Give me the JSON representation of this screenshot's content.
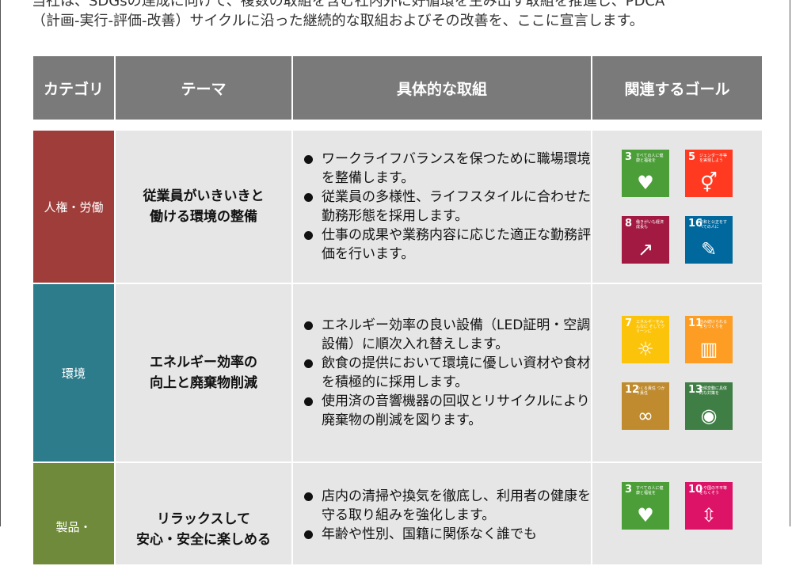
{
  "intro": {
    "line1": "当社は、SDGsの達成に向けて、複数の取組を含む社内外に好循環を生み出す取組を推進し、PDCA",
    "line2": "（計画-実行-評価-改善）サイクルに沿った継続的な取組およびその改善を、ここに宣言します。"
  },
  "table": {
    "headers": [
      "カテゴリ",
      "テーマ",
      "具体的な取組",
      "関連するゴール"
    ],
    "rows": [
      {
        "category": "人権・労働",
        "category_color": "#9e3d3a",
        "theme_line1": "従業員がいきいきと",
        "theme_line2": "働ける環境の整備",
        "actions": [
          "ワークライフバランスを保つために職場環境を整備します。",
          "従業員の多様性、ライフスタイルに合わせた勤務形態を採用します。",
          "仕事の成果や業務内容に応じた適正な勤務評価を行います。"
        ],
        "goals": [
          {
            "num": "3",
            "label": "すべての人に健康と福祉を",
            "color": "#4c9f38",
            "icon": "heartbeat-icon",
            "glyph": "♥"
          },
          {
            "num": "5",
            "label": "ジェンダー平等を実現しよう",
            "color": "#ff3a21",
            "icon": "gender-equality-icon",
            "glyph": "⚥"
          },
          {
            "num": "8",
            "label": "働きがいも経済成長も",
            "color": "#a21942",
            "icon": "growth-chart-icon",
            "glyph": "↗"
          },
          {
            "num": "16",
            "label": "平和と公正をすべての人に",
            "color": "#00689d",
            "icon": "dove-icon",
            "glyph": "✎"
          }
        ]
      },
      {
        "category": "環境",
        "category_color": "#2c7c8c",
        "theme_line1": "エネルギー効率の",
        "theme_line2": "向上と廃棄物削減",
        "actions": [
          "エネルギー効率の良い設備（LED証明・空調設備）に順次入れ替えします。",
          "飲食の提供において環境に優しい資材や食材を積極的に採用します。",
          "使用済の音響機器の回収とリサイクルにより廃棄物の削減を図ります。"
        ],
        "goals": [
          {
            "num": "7",
            "label": "エネルギーをみんなに そしてクリーンに",
            "color": "#fcc30b",
            "icon": "sun-icon",
            "glyph": "☼"
          },
          {
            "num": "11",
            "label": "住み続けられるまちづくりを",
            "color": "#fd9d24",
            "icon": "city-icon",
            "glyph": "▥"
          },
          {
            "num": "12",
            "label": "つくる責任 つかう責任",
            "color": "#bf8b2e",
            "icon": "infinity-icon",
            "glyph": "∞"
          },
          {
            "num": "13",
            "label": "気候変動に具体的な対策を",
            "color": "#3f7e44",
            "icon": "eye-globe-icon",
            "glyph": "◉"
          }
        ]
      },
      {
        "category": "製品・",
        "category_color": "#6f8a3a",
        "theme_line1": "リラックスして",
        "theme_line2": "安心・安全に楽しめる",
        "actions": [
          "店内の清掃や換気を徹底し、利用者の健康を守る取り組みを強化します。",
          "年齢や性別、国籍に関係なく誰でも"
        ],
        "goals": [
          {
            "num": "3",
            "label": "すべての人に健康と福祉を",
            "color": "#4c9f38",
            "icon": "heartbeat-icon",
            "glyph": "♥"
          },
          {
            "num": "10",
            "label": "人や国の不平等をなくそう",
            "color": "#dd1367",
            "icon": "equality-icon",
            "glyph": "⇳"
          }
        ]
      }
    ]
  }
}
